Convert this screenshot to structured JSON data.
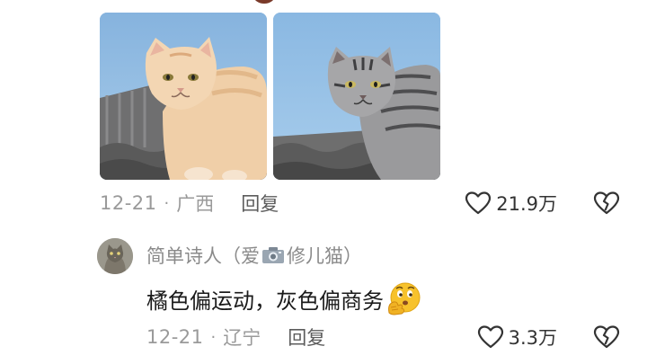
{
  "comment": {
    "images": [
      {
        "icon": "orange-cat-photo"
      },
      {
        "icon": "gray-tabby-cat-photo"
      }
    ],
    "date": "12-21",
    "separator": "·",
    "location": "广西",
    "reply_label": "回复",
    "likes": "21.9万",
    "like_icon": "heart-outline-icon",
    "dislike_icon": "broken-heart-icon"
  },
  "reply": {
    "avatar_icon": "cat-avatar",
    "username_prefix": "简单诗人（爱",
    "username_badge_icon": "camera-icon",
    "username_suffix": "修儿猫）",
    "text": "橘色偏运动，灰色偏商务",
    "emoji_icon": "thinking-hand-face-emoji",
    "date": "12-21",
    "separator": "·",
    "location": "辽宁",
    "reply_label": "回复",
    "likes": "3.3万"
  },
  "colors": {
    "meta_gray": "#9a9a9a",
    "text_dark": "#1a1a1a",
    "sky": "#8fb8df"
  }
}
